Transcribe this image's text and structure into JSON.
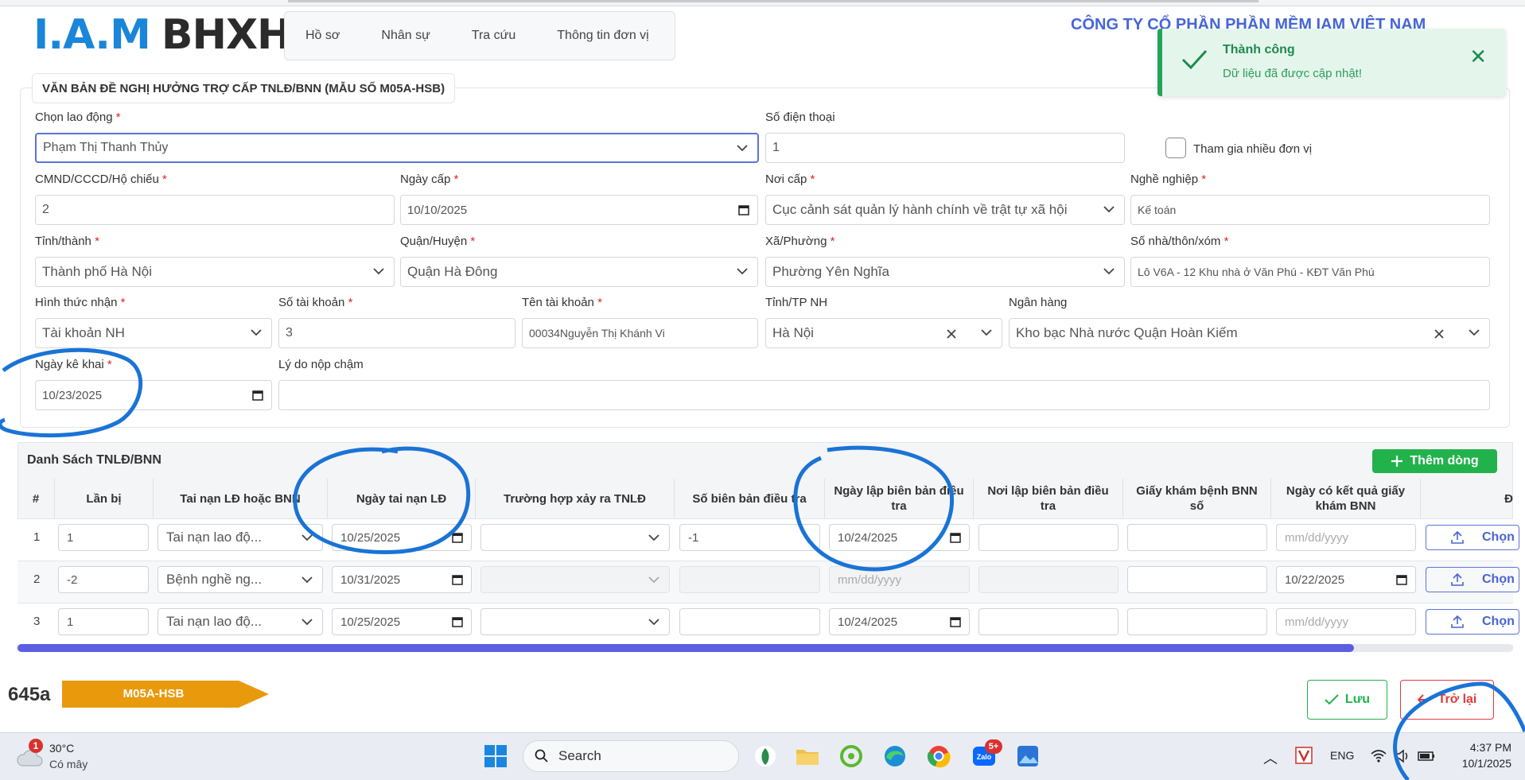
{
  "header": {
    "logo_iam": "I.A.M",
    "logo_bhxh": "BHXH",
    "company": "CÔNG TY CỔ PHẦN PHẦN MỀM IAM VIỆT NAM",
    "nav": [
      "Hồ sơ",
      "Nhân sự",
      "Tra cứu",
      "Thông tin đơn vị"
    ]
  },
  "toast": {
    "title": "Thành công",
    "message": "Dữ liệu đã được cập nhật!"
  },
  "form": {
    "title": "VĂN BẢN ĐỀ NGHỊ HƯỞNG TRỢ CẤP TNLĐ/BNN (MẪU SỐ M05A-HSB)",
    "required_mark": "*",
    "employee": {
      "label": "Chọn lao động",
      "value": "Phạm Thị Thanh Thủy"
    },
    "phone": {
      "label": "Số điện thoại",
      "value": "1"
    },
    "multi_unit": {
      "label": "Tham gia nhiều đơn vị"
    },
    "id_number": {
      "label": "CMND/CCCD/Hộ chiếu",
      "value": "2"
    },
    "issue_date": {
      "label": "Ngày cấp",
      "value": "10/10/2025"
    },
    "issue_place": {
      "label": "Nơi cấp",
      "value": "Cục cảnh sát quản lý hành chính về trật tự xã hội"
    },
    "occupation": {
      "label": "Nghề nghiệp",
      "value": "Kế toán"
    },
    "province": {
      "label": "Tỉnh/thành",
      "value": "Thành phố Hà Nội"
    },
    "district": {
      "label": "Quận/Huyện",
      "value": "Quận Hà Đông"
    },
    "ward": {
      "label": "Xã/Phường",
      "value": "Phường Yên Nghĩa"
    },
    "address": {
      "label": "Số nhà/thôn/xóm",
      "value": "Lô V6A - 12 Khu nhà ở Văn Phú - KĐT Văn Phú"
    },
    "receive_method": {
      "label": "Hình thức nhận",
      "value": "Tài khoản NH"
    },
    "account_number": {
      "label": "Số tài khoản",
      "value": "3"
    },
    "account_name": {
      "label": "Tên tài khoản",
      "value": "00034Nguyễn Thị Khánh Vi"
    },
    "bank_province": {
      "label": "Tỉnh/TP NH",
      "value": "Hà Nội"
    },
    "bank": {
      "label": "Ngân hàng",
      "value": "Kho bạc Nhà nước Quận Hoàn Kiếm"
    },
    "declare_date": {
      "label": "Ngày kê khai",
      "value": "10/23/2025"
    },
    "late_reason": {
      "label": "Lý do nộp chậm",
      "value": ""
    }
  },
  "table": {
    "title": "Danh Sách TNLĐ/BNN",
    "add_label": "Thêm dòng",
    "columns": [
      "#",
      "Lần bị",
      "Tai nạn LĐ hoặc BNN",
      "Ngày tai nạn LĐ",
      "Trường hợp xảy ra TNLĐ",
      "Số biên bản điều tra",
      "Ngày lập biên bản điều tra",
      "Nơi lập biên bản điều tra",
      "Giấy khám bệnh BNN số",
      "Ngày có kết quả giấy khám BNN",
      "Đ"
    ],
    "date_placeholder": "mm/dd/yyyy",
    "upload_label": "Chọn",
    "rows": [
      {
        "no": "1",
        "times": "1",
        "type": "Tai nạn lao độ...",
        "accident_date": "10/25/2025",
        "report_no": "-1",
        "report_date": "10/24/2025",
        "result_date": ""
      },
      {
        "no": "2",
        "times": "-2",
        "type": "Bệnh nghề ng...",
        "accident_date": "10/31/2025",
        "report_no": "",
        "report_date": "",
        "result_date": "10/22/2025"
      },
      {
        "no": "3",
        "times": "1",
        "type": "Tai nạn lao độ...",
        "accident_date": "10/25/2025",
        "report_no": "",
        "report_date": "10/24/2025",
        "result_date": ""
      }
    ]
  },
  "footer": {
    "code": "645a",
    "form_tag": "M05A-HSB",
    "save_label": "Lưu",
    "back_label": "Trở lại"
  },
  "taskbar": {
    "weather_badge": "1",
    "temperature": "30°C",
    "condition": "Có mây",
    "search": "Search",
    "zalo_badge": "5+",
    "language": "ENG",
    "time": "4:37 PM",
    "date": "10/1/2025"
  },
  "colors": {
    "accent": "#5b74d8",
    "success": "#22b24c",
    "danger": "#e23b3b",
    "tag": "#e89a0c",
    "annotation": "#1a73d6"
  }
}
